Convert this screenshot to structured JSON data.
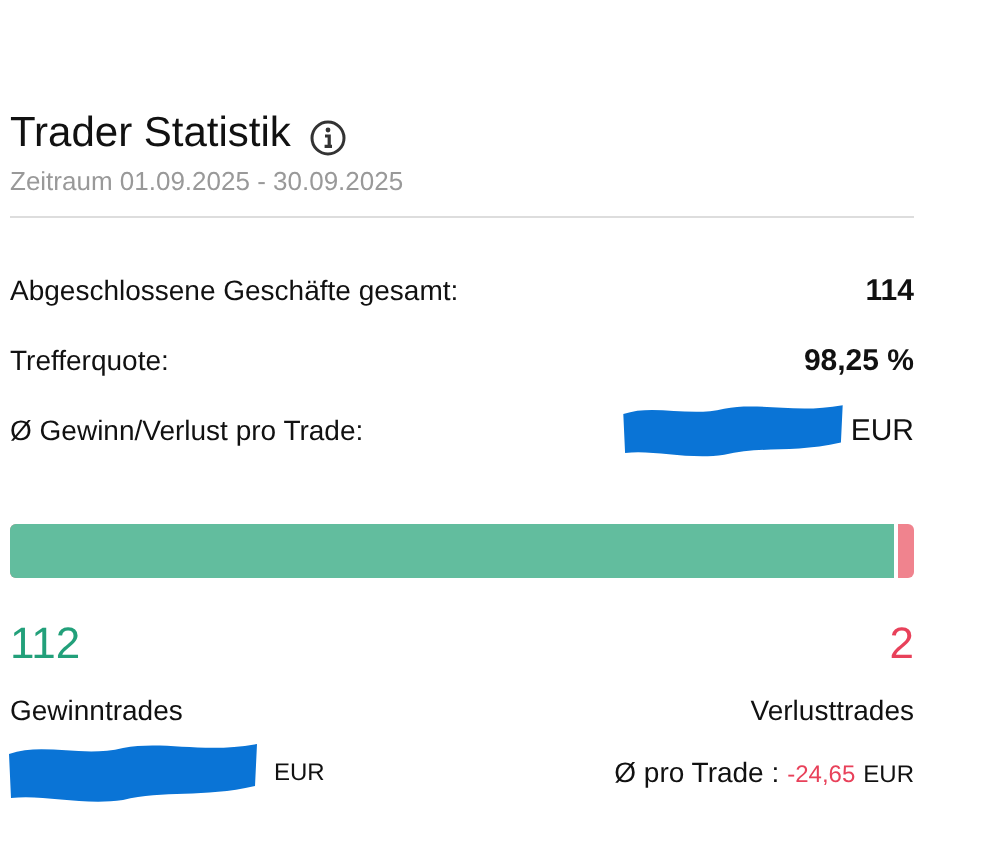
{
  "header": {
    "title": "Trader Statistik",
    "period": "Zeitraum 01.09.2025 - 30.09.2025"
  },
  "stats": [
    {
      "label": "Abgeschlossene Geschäfte gesamt:",
      "value": "114",
      "redacted": false
    },
    {
      "label": "Trefferquote:",
      "value": "98,25 %",
      "redacted": false
    },
    {
      "label": "Ø Gewinn/Verlust pro Trade:",
      "value": "EUR",
      "redacted": true
    }
  ],
  "ratio_bar": {
    "level": 0.982
  },
  "wins": {
    "count": "112",
    "label": "Gewinntrades",
    "currency": "EUR",
    "redacted": true
  },
  "losses": {
    "count": "2",
    "label": "Verlusttrades",
    "avg_label": "Ø pro Trade :",
    "avg_value": "-24,65",
    "currency": "EUR"
  }
}
